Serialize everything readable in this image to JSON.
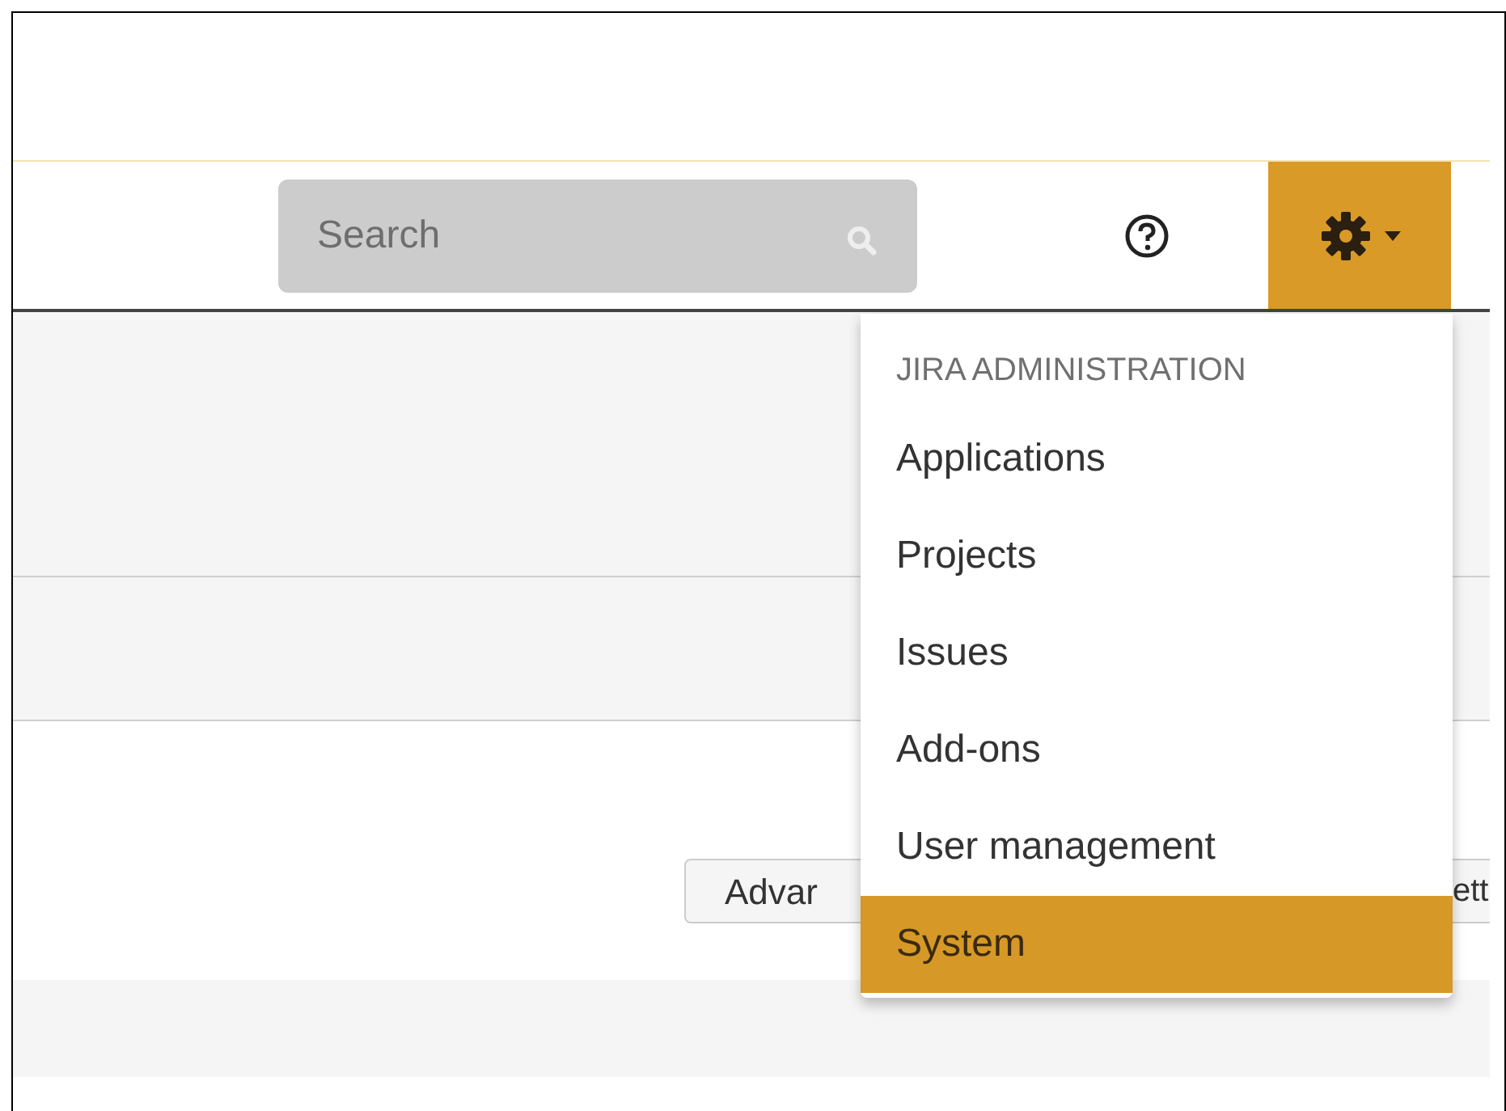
{
  "header": {
    "search": {
      "placeholder": "Search"
    }
  },
  "toolbar": {
    "buttons": [
      "Advar",
      "ett"
    ]
  },
  "admin_menu": {
    "heading": "JIRA ADMINISTRATION",
    "open": true,
    "items": [
      {
        "label": "Applications",
        "selected": false
      },
      {
        "label": "Projects",
        "selected": false
      },
      {
        "label": "Issues",
        "selected": false
      },
      {
        "label": "Add-ons",
        "selected": false
      },
      {
        "label": "User management",
        "selected": false
      },
      {
        "label": "System",
        "selected": true
      }
    ]
  }
}
